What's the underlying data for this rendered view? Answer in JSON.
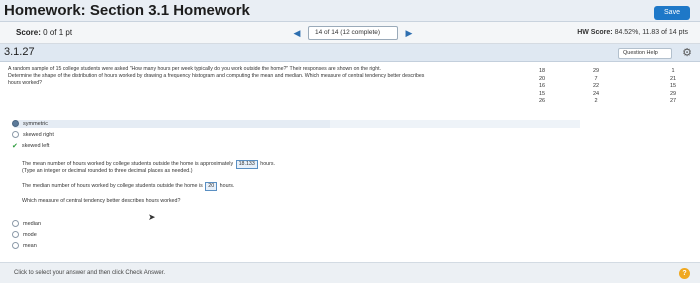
{
  "header": {
    "title": "Homework: Section 3.1 Homework",
    "save_label": "Save"
  },
  "scorebar": {
    "score_label": "Score:",
    "score_value": "0 of 1 pt",
    "question_select": "14 of 14 (12 complete)",
    "prev_icon": "arrow-left-icon",
    "next_icon": "arrow-right-icon",
    "hw_score_label": "HW Score:",
    "hw_score_value": "84.52%, 11.83 of 14 pts"
  },
  "question": {
    "number": "3.1.27",
    "help_label": "Question Help",
    "prompt_line1": "A random sample of 15 college students were asked \"How many hours per week typically do you work outside the home?\" Their responses are shown on the right.",
    "prompt_line2": "Determine the shape of the distribution of hours worked by drawing a frequency histogram and computing the mean and median. Which measure of central tendency better describes",
    "prompt_line3": "hours worked?"
  },
  "data_columns": [
    [
      "18",
      "20",
      "16",
      "15",
      "26"
    ],
    [
      "29",
      "7",
      "22",
      "24",
      "2"
    ],
    [
      "1",
      "21",
      "15",
      "29",
      "27"
    ]
  ],
  "shape_options": {
    "opt1": "symmetric",
    "opt2": "skewed right",
    "opt3": "skewed left"
  },
  "answers": {
    "mean_text_before": "The mean number of hours worked by college students outside the home is approximately",
    "mean_value": "18.133",
    "mean_text_after": "hours.",
    "mean_hint": "(Type an integer or decimal rounded to three decimal places as needed.)",
    "median_text_before": "The median number of hours worked by college students outside the home is",
    "median_value": "20",
    "median_text_after": "hours.",
    "central_question": "Which measure of central tendency better describes hours worked?"
  },
  "central_options": {
    "opt1": "median",
    "opt2": "mode",
    "opt3": "mean"
  },
  "footer": {
    "instruction": "Click to select your answer and then click Check Answer."
  }
}
